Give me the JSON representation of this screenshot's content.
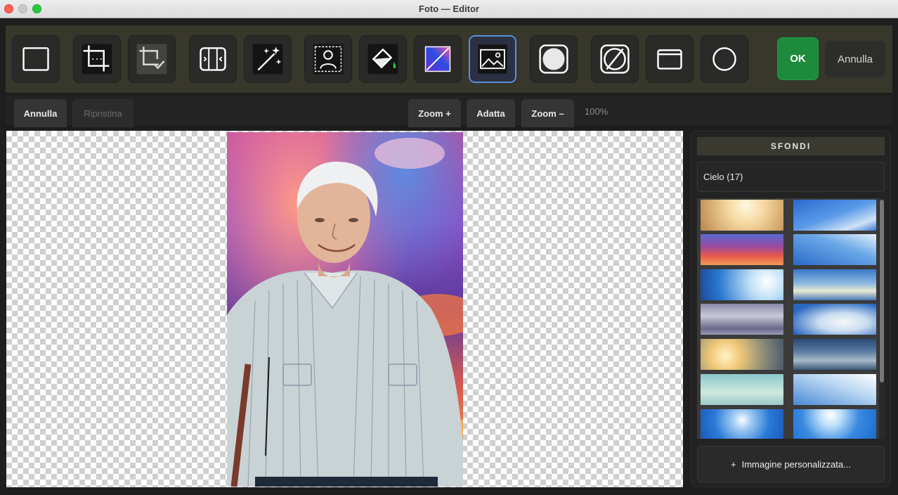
{
  "window": {
    "title": "Foto — Editor"
  },
  "toolbar": {
    "tools": [
      {
        "name": "frame-tool",
        "icon": "square-outline-icon"
      },
      {
        "name": "crop-tool",
        "icon": "crop-icon"
      },
      {
        "name": "crop-confirm-tool",
        "icon": "crop-check-icon"
      },
      {
        "name": "straighten-tool",
        "icon": "straighten-icon"
      },
      {
        "name": "magic-enhance-tool",
        "icon": "magic-wand-icon"
      },
      {
        "name": "portrait-select-tool",
        "icon": "person-select-icon"
      },
      {
        "name": "fill-tool",
        "icon": "paint-bucket-icon"
      },
      {
        "name": "gradient-tool",
        "icon": "gradient-icon"
      },
      {
        "name": "background-image-tool",
        "icon": "image-icon",
        "active": true
      },
      {
        "name": "white-fill-tool",
        "icon": "filled-circle-icon"
      },
      {
        "name": "transparent-tool",
        "icon": "no-fill-icon"
      },
      {
        "name": "window-frame-tool",
        "icon": "window-frame-icon"
      },
      {
        "name": "circle-tool",
        "icon": "circle-outline-icon"
      }
    ],
    "ok_label": "OK",
    "cancel_label": "Annulla"
  },
  "subbar": {
    "undo_label": "Annulla",
    "redo_label": "Ripristina",
    "zoom_in_label": "Zoom +",
    "fit_label": "Adatta",
    "zoom_out_label": "Zoom –",
    "zoom_level": "100%"
  },
  "panel": {
    "title": "SFONDI",
    "category": "Cielo  (17)",
    "thumbnails": [
      "sunset-gold",
      "blue-sky-clouds",
      "pink-purple-clouds",
      "blue-sky-light",
      "sun-rays-blue",
      "cloudy-blue",
      "grey-clouds",
      "cumulus-blue",
      "golden-clouds",
      "dark-blue-clouds",
      "teal-haze",
      "pale-blue-wisp",
      "sun-blue",
      "sun-burst-blue"
    ],
    "custom_image_label": "Immagine personalizzata..."
  },
  "colors": {
    "accent_active": "#5a8ed8",
    "ok_green": "#1d8a3c"
  }
}
